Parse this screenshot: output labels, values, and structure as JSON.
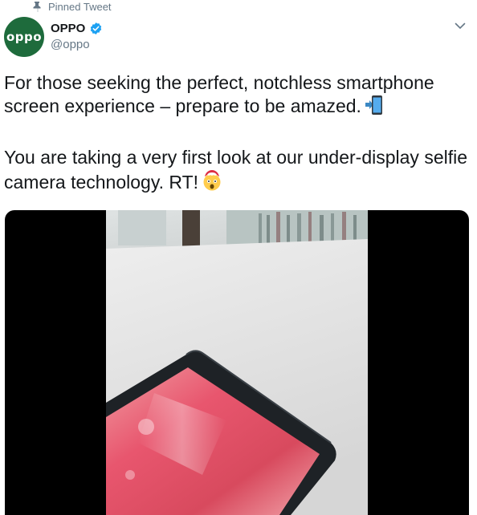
{
  "pinned": {
    "label": "Pinned Tweet",
    "icon": "pin-icon"
  },
  "author": {
    "display_name": "OPPO",
    "handle": "@oppo",
    "avatar_text": "oppo",
    "avatar_color": "#1e6b3c",
    "verified": true,
    "verified_color": "#1da1f2"
  },
  "tweet": {
    "paragraph1": "For those seeking the perfect, notchless smartphone screen experience – prepare to be amazed.",
    "paragraph1_emoji": "phone-with-arrow-emoji",
    "paragraph2": "You are taking a very first look at our under-display selfie camera technology. RT!",
    "paragraph2_emoji": "exploding-head-emoji"
  },
  "media": {
    "type": "video",
    "content": "phone-on-desk-video-frame"
  },
  "colors": {
    "text": "#14171a",
    "secondary": "#657786",
    "accent": "#1da1f2"
  }
}
